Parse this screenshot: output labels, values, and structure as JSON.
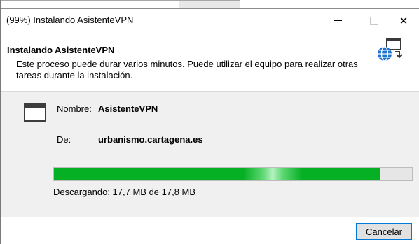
{
  "window": {
    "title": "(99%) Instalando AsistenteVPN",
    "controls": {
      "minimize_icon": "minimize-icon",
      "maximize_icon": "maximize-icon",
      "close_glyph": "✕"
    }
  },
  "header": {
    "title": "Instalando AsistenteVPN",
    "description": "Este proceso puede durar varios minutos. Puede utilizar el equipo para realizar otras tareas durante la instalación.",
    "icon": "globe-install-icon"
  },
  "details": {
    "app_icon": "application-window-icon",
    "name_label": "Nombre:",
    "name_value": "AsistenteVPN",
    "from_label": "De:",
    "from_value": "urbanismo.cartagena.es"
  },
  "progress": {
    "fraction": 0.9944,
    "text": "Descargando: 17,7 MB de 17,8 MB"
  },
  "footer": {
    "cancel_label": "Cancelar"
  },
  "colors": {
    "progress_fill": "#06b025",
    "button_focus_border": "#0078d7",
    "content_background": "#f0f0f0"
  }
}
